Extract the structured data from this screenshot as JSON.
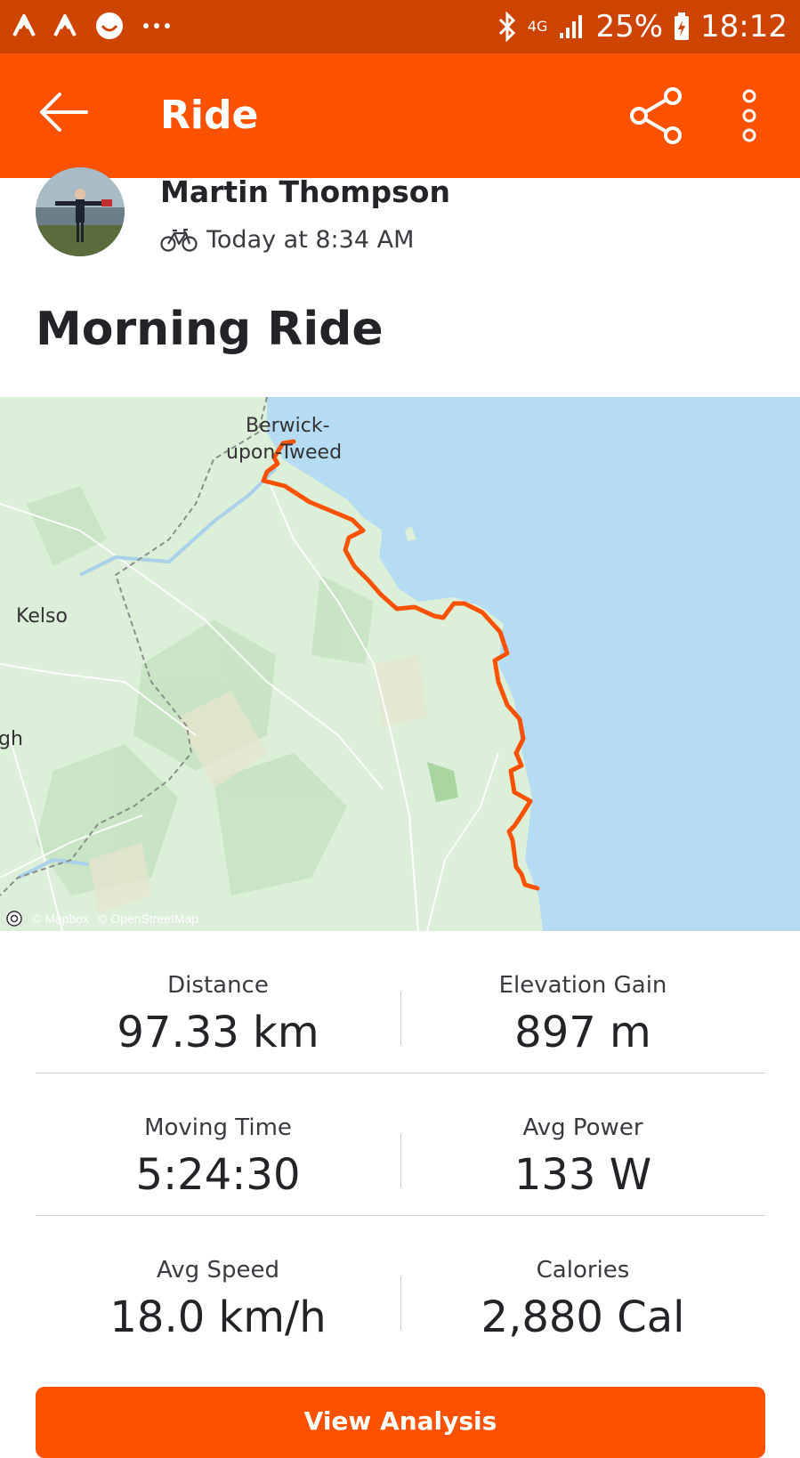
{
  "status_bar": {
    "network": "4G",
    "battery": "25%",
    "time": "18:12"
  },
  "app_bar": {
    "title": "Ride"
  },
  "athlete": {
    "name": "Martin Thompson",
    "timestamp": "Today at 8:34 AM"
  },
  "activity": {
    "title": "Morning Ride"
  },
  "map": {
    "labels": {
      "town_top": "Berwick-",
      "town_bottom": "upon-Tweed",
      "kelso": "Kelso",
      "edge": "gh"
    },
    "attribution": {
      "mapbox": "© Mapbox",
      "osm": "© OpenStreetMap"
    },
    "route_color": "#fc5200",
    "sea_color": "#b5dcf2"
  },
  "stats": [
    {
      "label": "Distance",
      "value": "97.33 km"
    },
    {
      "label": "Elevation Gain",
      "value": "897 m"
    },
    {
      "label": "Moving Time",
      "value": "5:24:30"
    },
    {
      "label": "Avg Power",
      "value": "133 W"
    },
    {
      "label": "Avg Speed",
      "value": "18.0 km/h"
    },
    {
      "label": "Calories",
      "value": "2,880 Cal"
    }
  ],
  "cta": {
    "label": "View Analysis"
  },
  "colors": {
    "brand": "#fc5200",
    "status_bar": "#cc4400"
  }
}
